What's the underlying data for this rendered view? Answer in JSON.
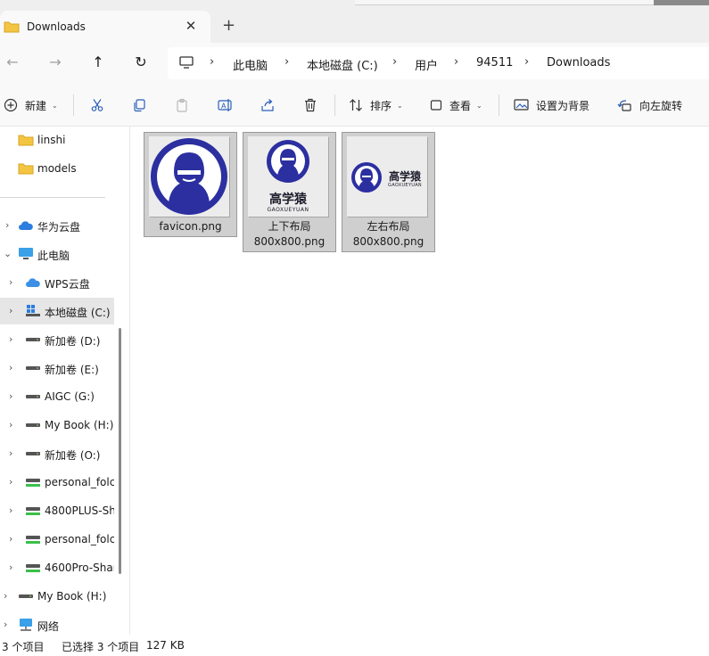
{
  "tab": {
    "title": "Downloads",
    "close_glyph": "✕",
    "newtab_glyph": "+"
  },
  "nav": {
    "back_glyph": "←",
    "forward_glyph": "→",
    "up_glyph": "↑",
    "refresh_glyph": "↻"
  },
  "breadcrumbs": [
    "此电脑",
    "本地磁盘 (C:)",
    "用户",
    "94511",
    "Downloads"
  ],
  "breadcrumb_sep": "›",
  "toolbar": {
    "new_label": "新建",
    "sort_label": "排序",
    "view_label": "查看",
    "set_bg_label": "设置为背景",
    "rotate_label": "向左旋转"
  },
  "sidebar": {
    "items": [
      {
        "label": "linshi",
        "icon": "folder-icon"
      },
      {
        "label": "models",
        "icon": "folder-icon"
      },
      {
        "label": "华为云盘",
        "icon": "cloud-icon"
      },
      {
        "label": "此电脑",
        "icon": "computer-icon"
      },
      {
        "label": "WPS云盘",
        "icon": "cloud-icon"
      },
      {
        "label": "本地磁盘 (C:)",
        "icon": "windows-drive-icon"
      },
      {
        "label": "新加卷 (D:)",
        "icon": "drive-icon"
      },
      {
        "label": "新加卷 (E:)",
        "icon": "drive-icon"
      },
      {
        "label": "AIGC (G:)",
        "icon": "drive-icon"
      },
      {
        "label": "My Book (H:)",
        "icon": "drive-icon"
      },
      {
        "label": "新加卷 (O:)",
        "icon": "drive-icon"
      },
      {
        "label": "personal_folc",
        "icon": "network-drive-icon"
      },
      {
        "label": "4800PLUS-Sh",
        "icon": "network-drive-icon"
      },
      {
        "label": "personal_folc",
        "icon": "network-drive-icon"
      },
      {
        "label": "4600Pro-Shar",
        "icon": "network-drive-icon"
      },
      {
        "label": "My Book (H:)",
        "icon": "drive-icon"
      },
      {
        "label": "网络",
        "icon": "network-icon"
      }
    ]
  },
  "files": [
    {
      "name_line1": "favicon.png",
      "name_line2": "",
      "logo_text": "",
      "logo_sub": ""
    },
    {
      "name_line1": "上下布局",
      "name_line2": "800x800.png",
      "logo_text": "高学猿",
      "logo_sub": "GAOXUEYUAN"
    },
    {
      "name_line1": "左右布局",
      "name_line2": "800x800.png",
      "logo_text": "高学猿",
      "logo_sub": "GAOXUEYUAN"
    }
  ],
  "status": {
    "count": "3 个项目",
    "selected": "已选择 3 个项目",
    "size": "127 KB"
  },
  "colors": {
    "brand": "#2b2fa0",
    "selection": "#cfcfcf",
    "folder": "#f4c542"
  }
}
